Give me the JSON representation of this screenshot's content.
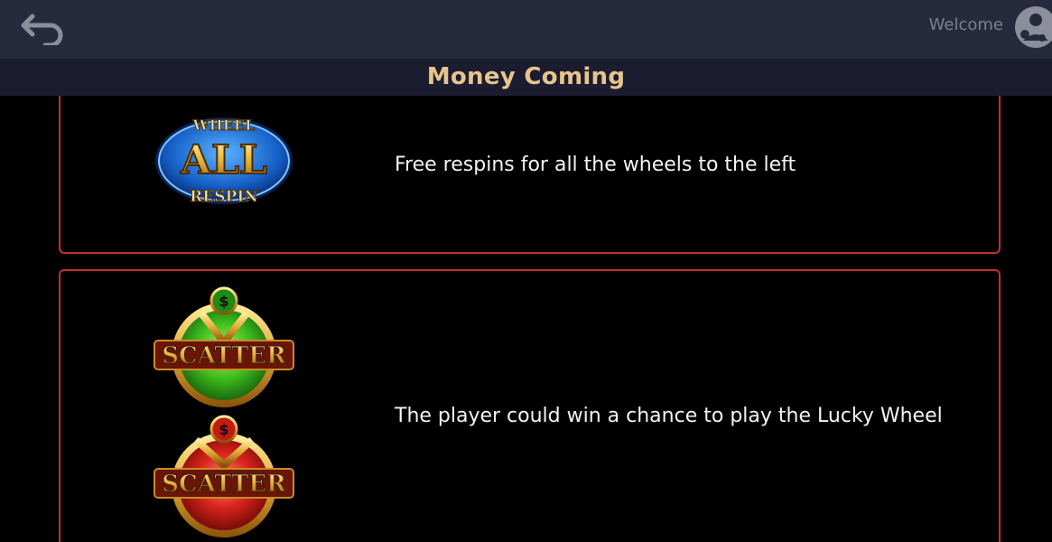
{
  "header": {
    "back_icon": "back-arrow-icon",
    "welcome_text": "Welcome",
    "avatar_icon": "user-avatar-icon"
  },
  "page": {
    "title": "Money Coming"
  },
  "rules": [
    {
      "symbols": [
        {
          "name": "wheel-all-respin-icon",
          "top_text": "WHEEL",
          "main_text": "ALL",
          "bottom_text": "RESPIN"
        }
      ],
      "description": "Free respins for all the wheels to the left"
    },
    {
      "symbols": [
        {
          "name": "green-scatter-icon",
          "main_text": "SCATTER",
          "badge": "$",
          "color": "#3fbf1e"
        },
        {
          "name": "red-scatter-icon",
          "main_text": "SCATTER",
          "badge": "$",
          "color": "#d8231c"
        }
      ],
      "description": "The player could win a chance to play the Lucky Wheel"
    }
  ],
  "colors": {
    "header_bg": "#272a3d",
    "title_bar_bg": "#1b1c30",
    "title_text": "#e8c48c",
    "card_border": "#c62d2d",
    "body_text": "#f4f4f4"
  }
}
